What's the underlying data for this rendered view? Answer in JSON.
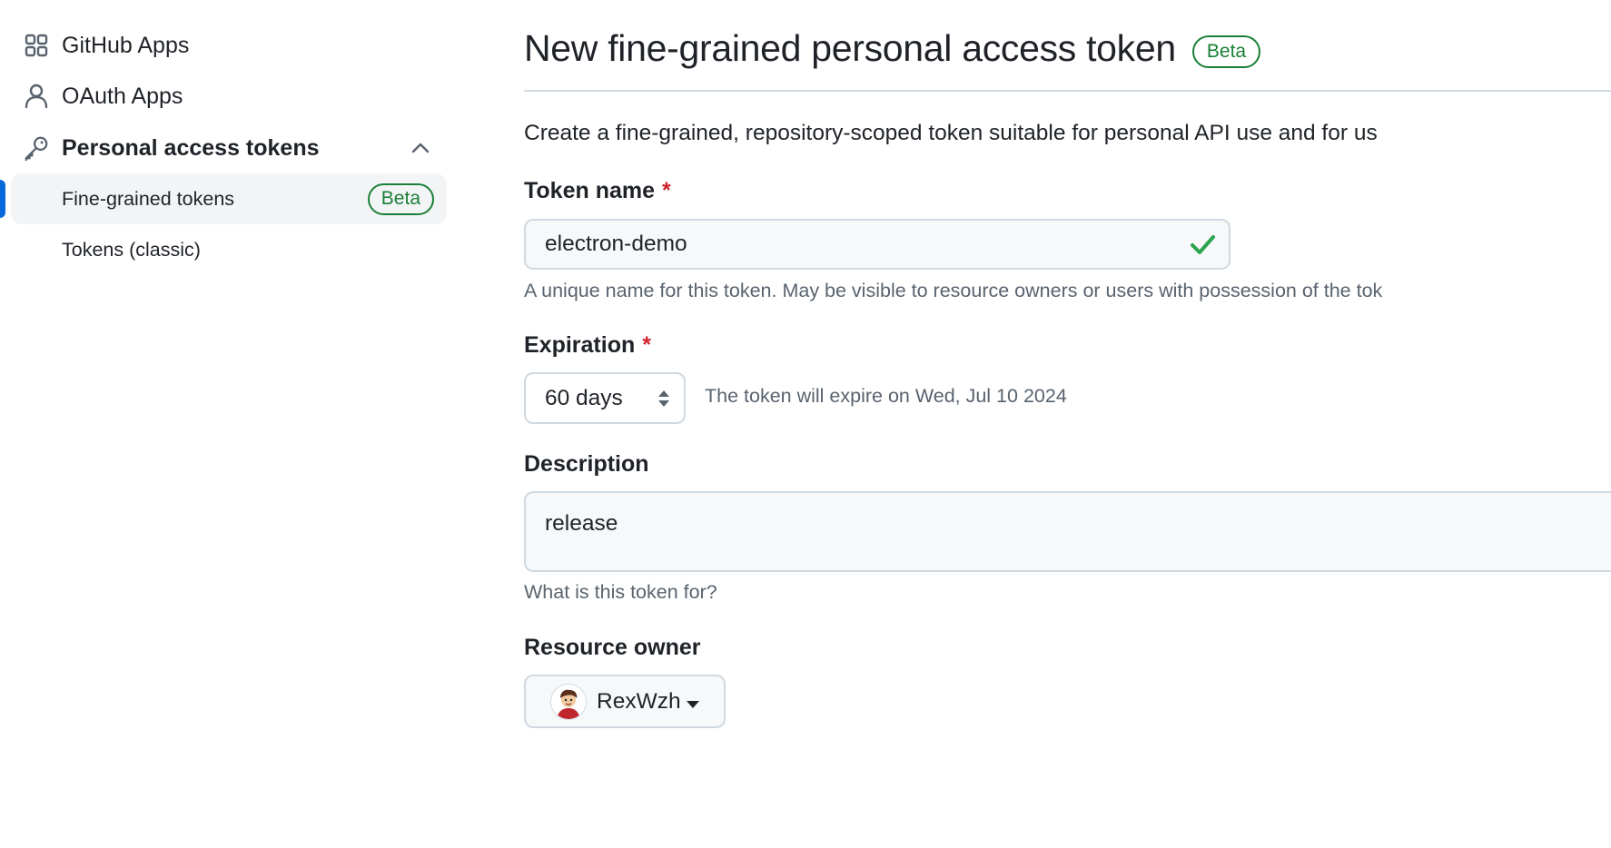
{
  "sidebar": {
    "items": [
      {
        "label": "GitHub Apps",
        "icon": "apps-grid-icon"
      },
      {
        "label": "OAuth Apps",
        "icon": "person-icon"
      },
      {
        "label": "Personal access tokens",
        "icon": "key-icon",
        "expanded": true
      }
    ],
    "sub_items": [
      {
        "label": "Fine-grained tokens",
        "badge": "Beta",
        "active": true
      },
      {
        "label": "Tokens (classic)"
      }
    ]
  },
  "main": {
    "title": "New fine-grained personal access token",
    "title_badge": "Beta",
    "intro": "Create a fine-grained, repository-scoped token suitable for personal API use and for us",
    "token_name": {
      "label": "Token name",
      "required_mark": "*",
      "value": "electron-demo",
      "hint": "A unique name for this token. May be visible to resource owners or users with possession of the tok"
    },
    "expiration": {
      "label": "Expiration",
      "required_mark": "*",
      "selected": "60 days",
      "note": "The token will expire on Wed, Jul 10 2024"
    },
    "description": {
      "label": "Description",
      "value": "release",
      "hint": "What is this token for?"
    },
    "resource_owner": {
      "label": "Resource owner",
      "selected": "RexWzh"
    }
  },
  "colors": {
    "accent": "#0969da",
    "success": "#1a7f37",
    "check": "#2da44e",
    "required": "#d1242f",
    "muted_text": "#59636e",
    "border": "#d1d9e0",
    "input_bg": "#f6f8fa"
  }
}
